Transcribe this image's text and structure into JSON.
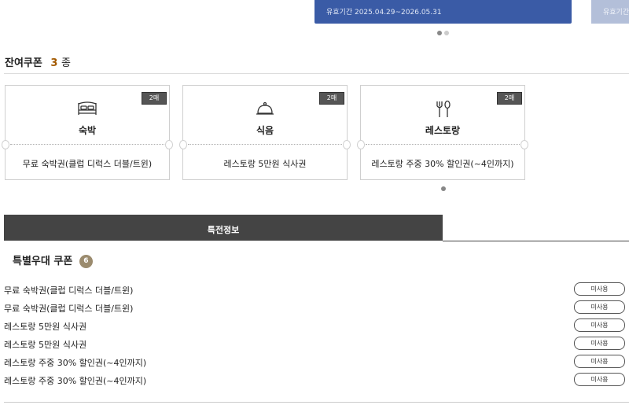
{
  "membership_card": {
    "validity": "유효기간 2025.04.29~2026.05.31",
    "validity_next": "유효기간"
  },
  "remaining_coupons": {
    "title": "잔여쿠폰",
    "count": "3",
    "unit": "종",
    "items": [
      {
        "badge": "2매",
        "icon": "bed-icon",
        "name": "숙박",
        "desc": "무료 숙박권(클럽 디럭스 더블/트윈)"
      },
      {
        "badge": "2매",
        "icon": "cloche-icon",
        "name": "식음",
        "desc": "레스토랑 5만원 식사권"
      },
      {
        "badge": "2매",
        "icon": "fork-spoon-icon",
        "name": "레스토랑",
        "desc": "레스토랑 주중 30% 할인권(~4인까지)"
      }
    ]
  },
  "tab": {
    "label": "특전정보"
  },
  "special": {
    "title": "특별우대 쿠폰",
    "count": "6",
    "status_label": "미사용",
    "rows": [
      "무료 숙박권(클럽 디럭스 더블/트윈)",
      "무료 숙박권(클럽 디럭스 더블/트윈)",
      "레스토랑 5만원 식사권",
      "레스토랑 5만원 식사권",
      "레스토랑 주중 30% 할인권(~4인까지)",
      "레스토랑 주중 30% 할인권(~4인까지)"
    ]
  },
  "colors": {
    "card_blue": "#3a5ba6",
    "badge_dark": "#555555",
    "count_accent": "#a35a00",
    "pill": "#9b8b6e"
  }
}
